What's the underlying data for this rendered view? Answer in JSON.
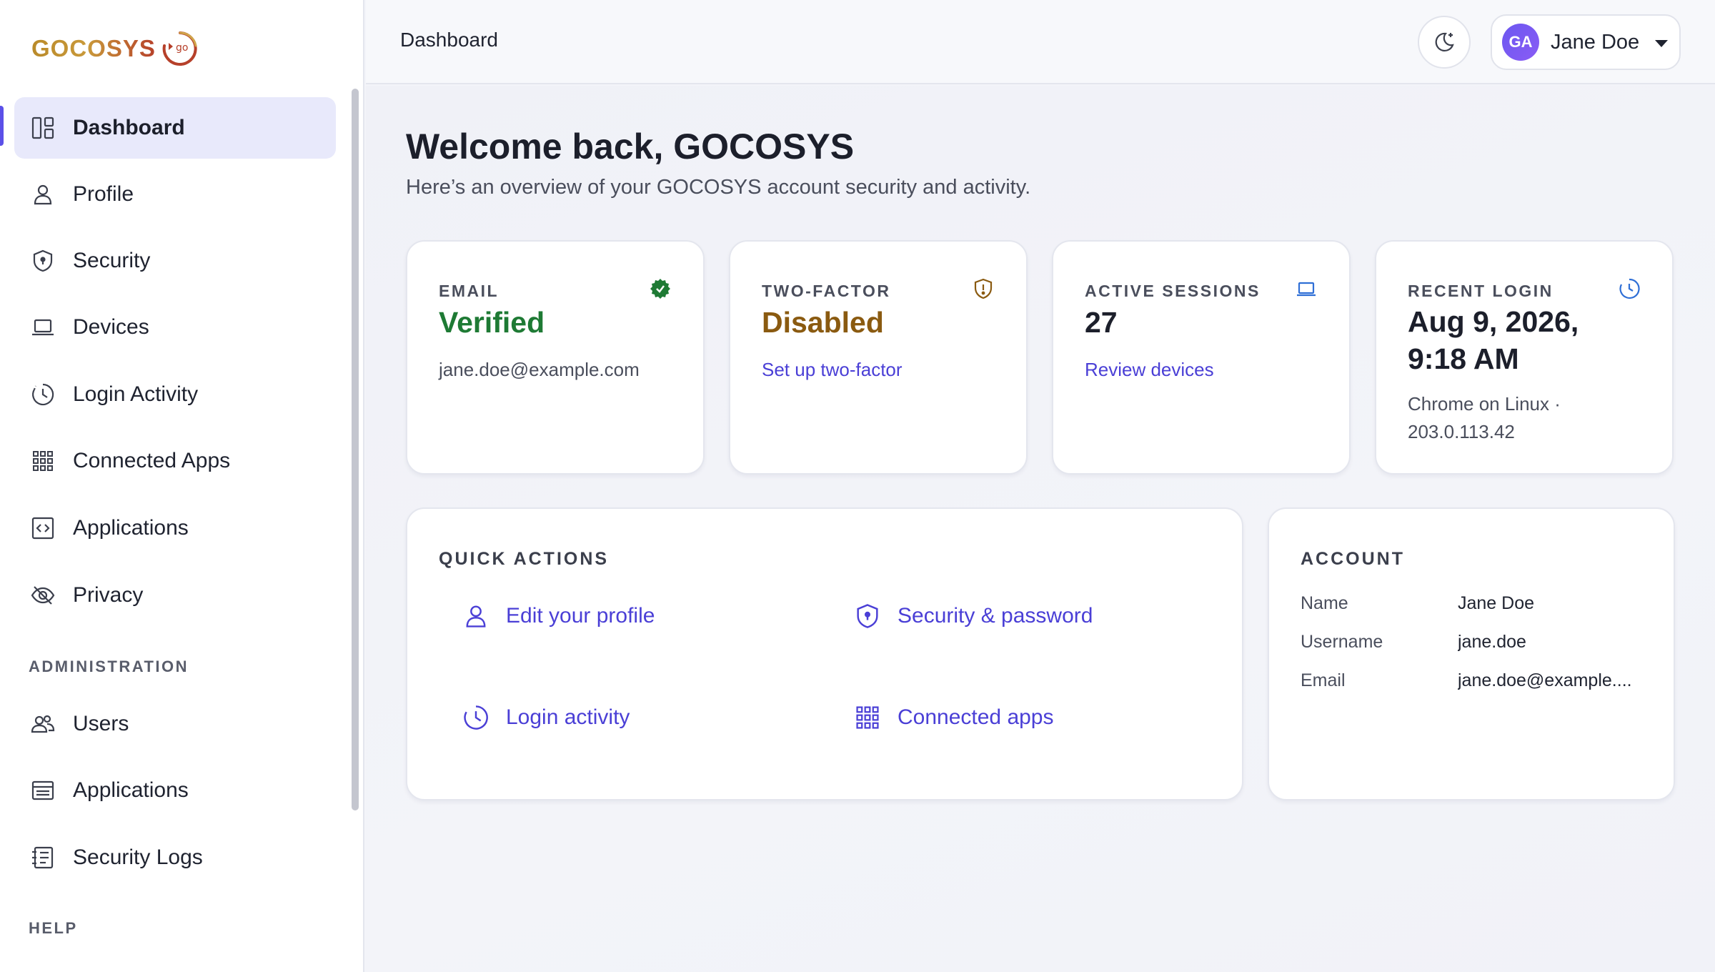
{
  "brand": {
    "logo_text": "GOCOSYS",
    "logo_badge": "go"
  },
  "sidebar": {
    "items": [
      {
        "label": "Dashboard",
        "icon": "dashboard-icon"
      },
      {
        "label": "Profile",
        "icon": "user-icon"
      },
      {
        "label": "Security",
        "icon": "shield-icon"
      },
      {
        "label": "Devices",
        "icon": "laptop-icon"
      },
      {
        "label": "Login Activity",
        "icon": "clock-icon"
      },
      {
        "label": "Connected Apps",
        "icon": "grid-icon"
      },
      {
        "label": "Applications",
        "icon": "code-icon"
      },
      {
        "label": "Privacy",
        "icon": "eye-off-icon"
      }
    ],
    "admin_label": "ADMINISTRATION",
    "admin_items": [
      {
        "label": "Users",
        "icon": "users-icon"
      },
      {
        "label": "Applications",
        "icon": "browser-window-icon"
      },
      {
        "label": "Security Logs",
        "icon": "log-list-icon"
      }
    ],
    "help_label": "HELP"
  },
  "header": {
    "title": "Dashboard",
    "user": {
      "initials": "GA",
      "name": "Jane Doe"
    }
  },
  "main": {
    "welcome": "Welcome back, GOCOSYS",
    "subtitle": "Here’s an overview of your GOCOSYS account security and activity.",
    "stats": [
      {
        "label": "EMAIL",
        "value": "Verified",
        "sub": "jane.doe@example.com",
        "value_color": "#1e7a34",
        "icon": "verified-badge-icon"
      },
      {
        "label": "TWO-FACTOR",
        "value": "Disabled",
        "link": "Set up two-factor",
        "value_color": "#8a5a10",
        "icon": "shield-alert-icon"
      },
      {
        "label": "ACTIVE SESSIONS",
        "value": "27",
        "link": "Review devices",
        "value_color": "#1c1f2b",
        "icon": "laptop-icon"
      },
      {
        "label": "RECENT LOGIN",
        "value_line1": "Aug 9, 2026,",
        "value_line2": "9:18 AM",
        "sub_line1": "Chrome on Linux ·",
        "sub_line2": "203.0.113.42",
        "value_color": "#1c1f2b",
        "icon": "clock-icon"
      }
    ],
    "quick_actions": {
      "heading": "QUICK ACTIONS",
      "items": [
        {
          "label": "Edit your profile",
          "icon": "user-icon"
        },
        {
          "label": "Security & password",
          "icon": "shield-icon"
        },
        {
          "label": "Login activity",
          "icon": "clock-icon"
        },
        {
          "label": "Connected apps",
          "icon": "grid-icon"
        }
      ]
    },
    "account": {
      "heading": "ACCOUNT",
      "rows": [
        {
          "key": "Name",
          "value": "Jane Doe"
        },
        {
          "key": "Username",
          "value": "jane.doe"
        },
        {
          "key": "Email",
          "value": "jane.doe@example...."
        }
      ]
    }
  },
  "colors": {
    "accent": "#4a3fd6",
    "verified": "#1e7a34",
    "warning": "#8a5a10",
    "active_nav_bg": "#e8e9fb"
  }
}
